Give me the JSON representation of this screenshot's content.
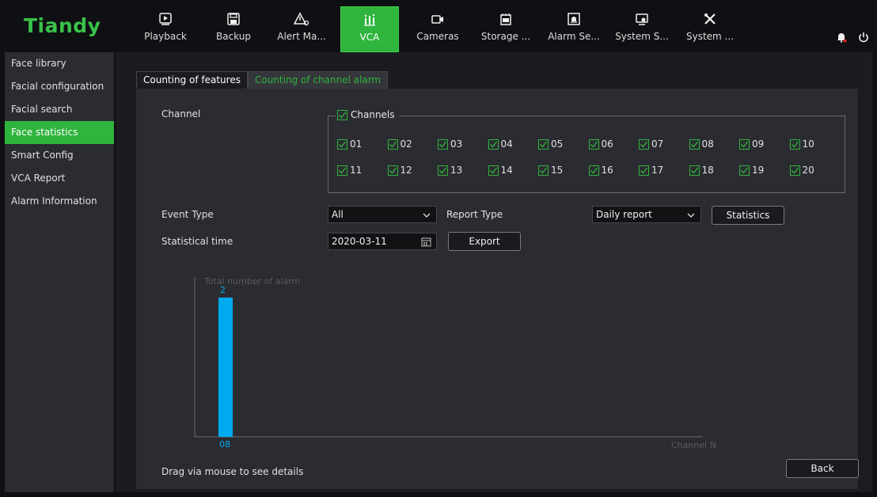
{
  "app": {
    "logo": "Tiandy"
  },
  "nav": [
    {
      "label": "Playback",
      "icon": "playback-icon"
    },
    {
      "label": "Backup",
      "icon": "floppy-icon"
    },
    {
      "label": "Alert Ma...",
      "icon": "alert-icon"
    },
    {
      "label": "VCA",
      "icon": "vca-icon",
      "active": true
    },
    {
      "label": "Cameras",
      "icon": "camera-icon"
    },
    {
      "label": "Storage ...",
      "icon": "storage-icon"
    },
    {
      "label": "Alarm Se...",
      "icon": "alarm-settings-icon"
    },
    {
      "label": "System S...",
      "icon": "system-settings-icon"
    },
    {
      "label": "System ...",
      "icon": "tools-icon"
    }
  ],
  "sidebar": {
    "items": [
      {
        "label": "Face library"
      },
      {
        "label": "Facial configuration"
      },
      {
        "label": "Facial search"
      },
      {
        "label": "Face statistics",
        "active": true
      },
      {
        "label": "Smart Config"
      },
      {
        "label": "VCA Report"
      },
      {
        "label": "Alarm Information"
      }
    ]
  },
  "tabs": [
    {
      "label": "Counting of features"
    },
    {
      "label": "Counting of channel alarm",
      "active": true
    }
  ],
  "form": {
    "channel_label": "Channel",
    "channels_group_label": "Channels",
    "channels": [
      "01",
      "02",
      "03",
      "04",
      "05",
      "06",
      "07",
      "08",
      "09",
      "10",
      "11",
      "12",
      "13",
      "14",
      "15",
      "16",
      "17",
      "18",
      "19",
      "20"
    ],
    "event_type_label": "Event Type",
    "event_type_value": "All",
    "report_type_label": "Report Type",
    "report_type_value": "Daily report",
    "statistics_button": "Statistics",
    "stat_time_label": "Statistical time",
    "stat_time_value": "2020-03-11",
    "export_button": "Export",
    "drag_hint": "Drag via mouse to see details",
    "back_button": "Back"
  },
  "colors": {
    "accent": "#2fb43d",
    "bar": "#00aaf0",
    "panel": "#2b2c31"
  },
  "chart_data": {
    "type": "bar",
    "ylabel": "Total number of alarm",
    "xlabel": "Channel N",
    "categories": [
      "08"
    ],
    "values": [
      2
    ],
    "ylim": [
      0,
      2
    ]
  }
}
